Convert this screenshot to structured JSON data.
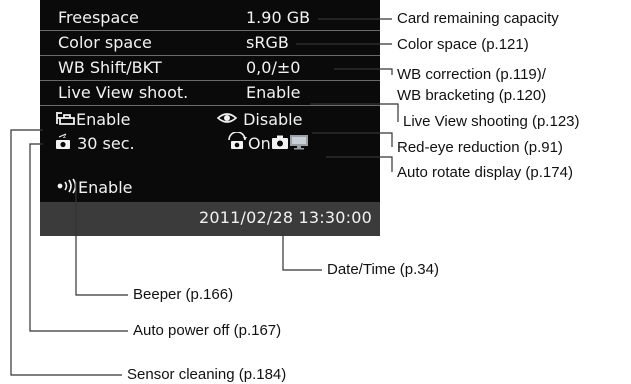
{
  "screen": {
    "rows": {
      "freespace": {
        "label": "Freespace",
        "value": "1.90 GB"
      },
      "colorspace": {
        "label": "Color space",
        "value": "sRGB"
      },
      "wbshift": {
        "label": "WB Shift/BKT",
        "value": "0,0/±0"
      },
      "liveview": {
        "label": "Live View shoot.",
        "value": "Enable"
      },
      "sensor_clean": {
        "value": "Enable"
      },
      "redeye": {
        "value": "Disable"
      },
      "autopower": {
        "value": "30 sec."
      },
      "autorotate": {
        "value": "On"
      },
      "beeper": {
        "value": "Enable"
      }
    },
    "datetime": "2011/02/28  13:30:00"
  },
  "callouts": {
    "card_capacity": "Card remaining capacity",
    "color_space": "Color space (p.121)",
    "wb_correction": "WB correction (p.119)/",
    "wb_bracketing": "WB bracketing (p.120)",
    "live_view": "Live View shooting (p.123)",
    "red_eye": "Red-eye reduction (p.91)",
    "auto_rotate": "Auto rotate display (p.174)",
    "date_time": "Date/Time (p.34)",
    "beeper": "Beeper (p.166)",
    "auto_power_off": "Auto power off (p.167)",
    "sensor_cleaning": "Sensor cleaning (p.184)"
  },
  "colors": {
    "screen_bg": "#0a0a0a",
    "date_bar": "#3b3b3b",
    "text": "#f2f2f2",
    "leader": "#333333"
  },
  "icons": [
    "sensor-cleaning-icon",
    "red-eye-icon",
    "auto-power-off-icon",
    "auto-rotate-icon",
    "camera-icon",
    "monitor-icon",
    "beeper-icon"
  ]
}
